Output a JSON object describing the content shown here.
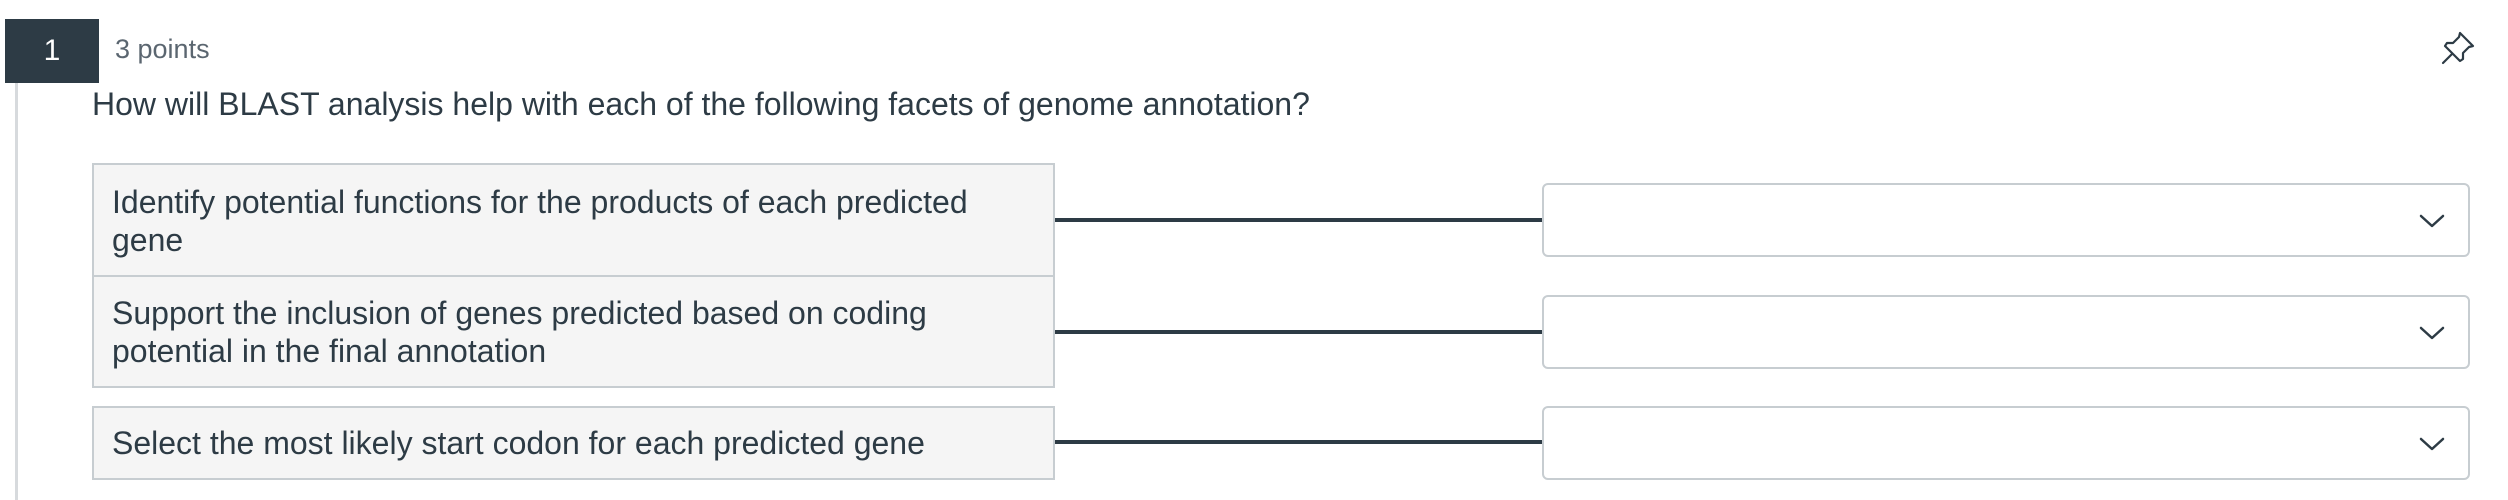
{
  "question": {
    "number": "1",
    "points": "3 points",
    "prompt": "How will BLAST analysis help with each of the following facets of genome annotation?",
    "pin_icon": "pin-icon"
  },
  "matches": [
    {
      "label": "Identify potential functions for the products of each predicted gene",
      "selected": "",
      "dropdown_icon": "chevron-down-icon"
    },
    {
      "label": "Support the inclusion of genes predicted based on coding potential in the final annotation",
      "selected": "",
      "dropdown_icon": "chevron-down-icon"
    },
    {
      "label": "Select the most likely start codon for each predicted gene",
      "selected": "",
      "dropdown_icon": "chevron-down-icon"
    }
  ],
  "colors": {
    "badge_bg": "#2d3b45",
    "text": "#2d3b45",
    "label_bg": "#f5f5f5",
    "border": "#c7cdd1"
  }
}
